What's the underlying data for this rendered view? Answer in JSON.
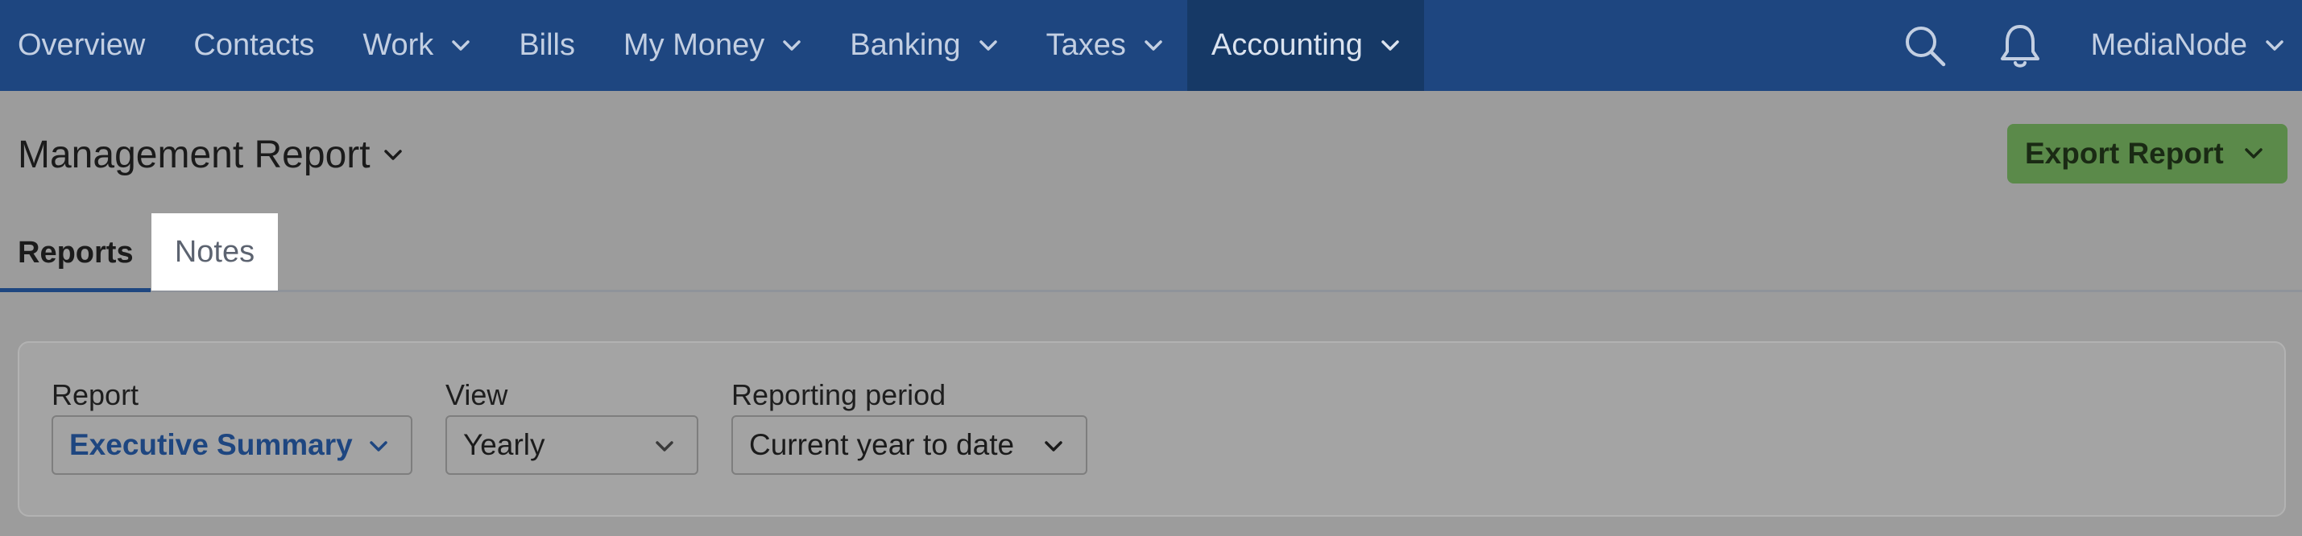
{
  "nav": {
    "items": [
      {
        "label": "Overview",
        "dropdown": false
      },
      {
        "label": "Contacts",
        "dropdown": false
      },
      {
        "label": "Work",
        "dropdown": true
      },
      {
        "label": "Bills",
        "dropdown": false
      },
      {
        "label": "My Money",
        "dropdown": true
      },
      {
        "label": "Banking",
        "dropdown": true
      },
      {
        "label": "Taxes",
        "dropdown": true
      },
      {
        "label": "Accounting",
        "dropdown": true,
        "active": true
      }
    ],
    "search_icon": "search-icon",
    "notifications_icon": "bell-icon",
    "org_name": "MediaNode"
  },
  "header": {
    "title": "Management Report",
    "export_label": "Export Report"
  },
  "tabs": [
    {
      "label": "Reports",
      "selected": true
    },
    {
      "label": "Notes",
      "selected": false
    }
  ],
  "filters": {
    "report": {
      "label": "Report",
      "value": "Executive Summary"
    },
    "view": {
      "label": "View",
      "value": "Yearly"
    },
    "period": {
      "label": "Reporting period",
      "value": "Current year to date"
    }
  },
  "colors": {
    "nav_bg": "#1e4680",
    "nav_active": "#163966",
    "export_button": "#5b8a4a",
    "tab_underline": "#1e4680"
  }
}
